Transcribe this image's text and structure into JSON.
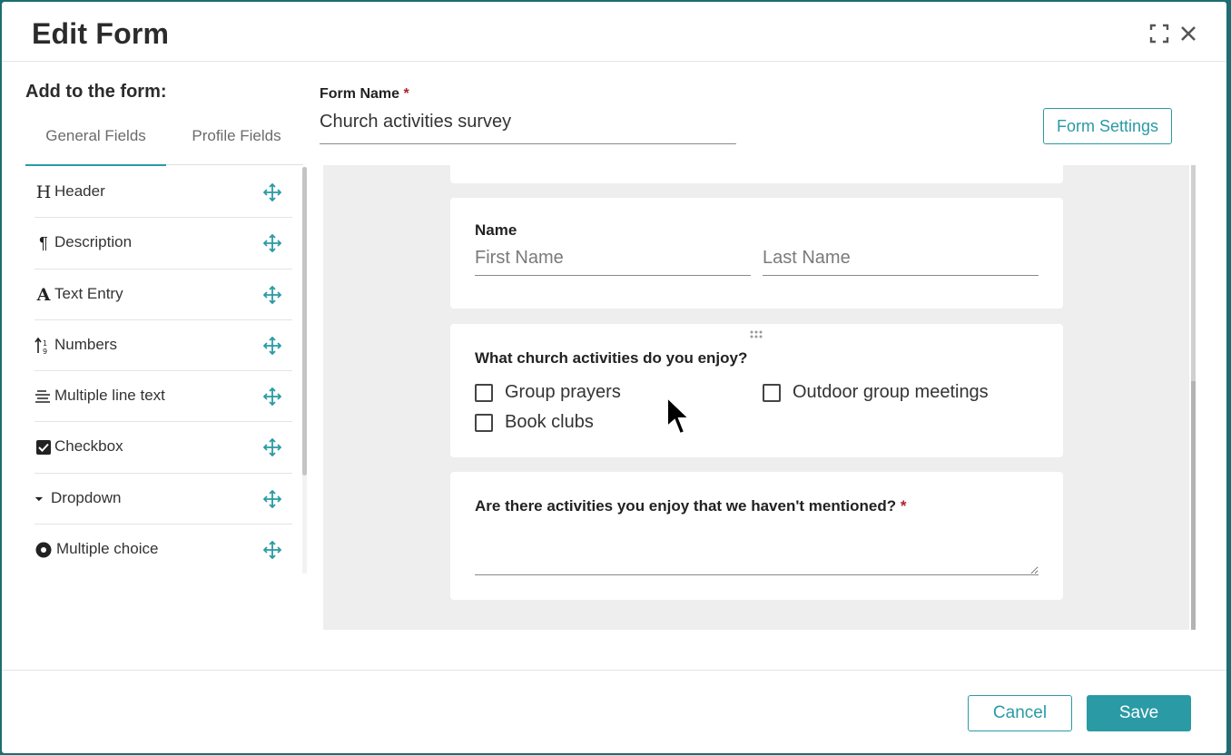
{
  "modal": {
    "title": "Edit Form"
  },
  "left_panel": {
    "title": "Add to the form:",
    "tabs": [
      {
        "label": "General Fields"
      },
      {
        "label": "Profile Fields"
      }
    ],
    "fields": [
      {
        "icon": "header-icon",
        "label": "Header"
      },
      {
        "icon": "paragraph-icon",
        "label": "Description"
      },
      {
        "icon": "text-entry-icon",
        "label": "Text Entry"
      },
      {
        "icon": "numbers-icon",
        "label": "Numbers"
      },
      {
        "icon": "multiline-icon",
        "label": "Multiple line text"
      },
      {
        "icon": "checkbox-icon",
        "label": "Checkbox"
      },
      {
        "icon": "dropdown-icon",
        "label": "Dropdown"
      },
      {
        "icon": "radio-icon",
        "label": "Multiple choice"
      }
    ]
  },
  "form": {
    "name_label": "Form Name",
    "required_mark": "*",
    "name_value": "Church activities survey",
    "settings_label": "Form Settings",
    "name_field": {
      "label": "Name",
      "first_placeholder": "First Name",
      "last_placeholder": "Last Name"
    },
    "activities": {
      "question": "What church activities do you enjoy?",
      "options": [
        {
          "label": "Group prayers",
          "checked": false
        },
        {
          "label": "Outdoor group meetings",
          "checked": false
        },
        {
          "label": "Book clubs",
          "checked": false
        }
      ]
    },
    "other": {
      "question": "Are there activities you enjoy that we haven't mentioned?",
      "required_mark": "*"
    }
  },
  "footer": {
    "cancel_label": "Cancel",
    "save_label": "Save"
  },
  "colors": {
    "accent": "#2a9aa5",
    "required": "#b01f2e",
    "backdrop": "#1d6e73",
    "canvas": "#eeeeef"
  }
}
